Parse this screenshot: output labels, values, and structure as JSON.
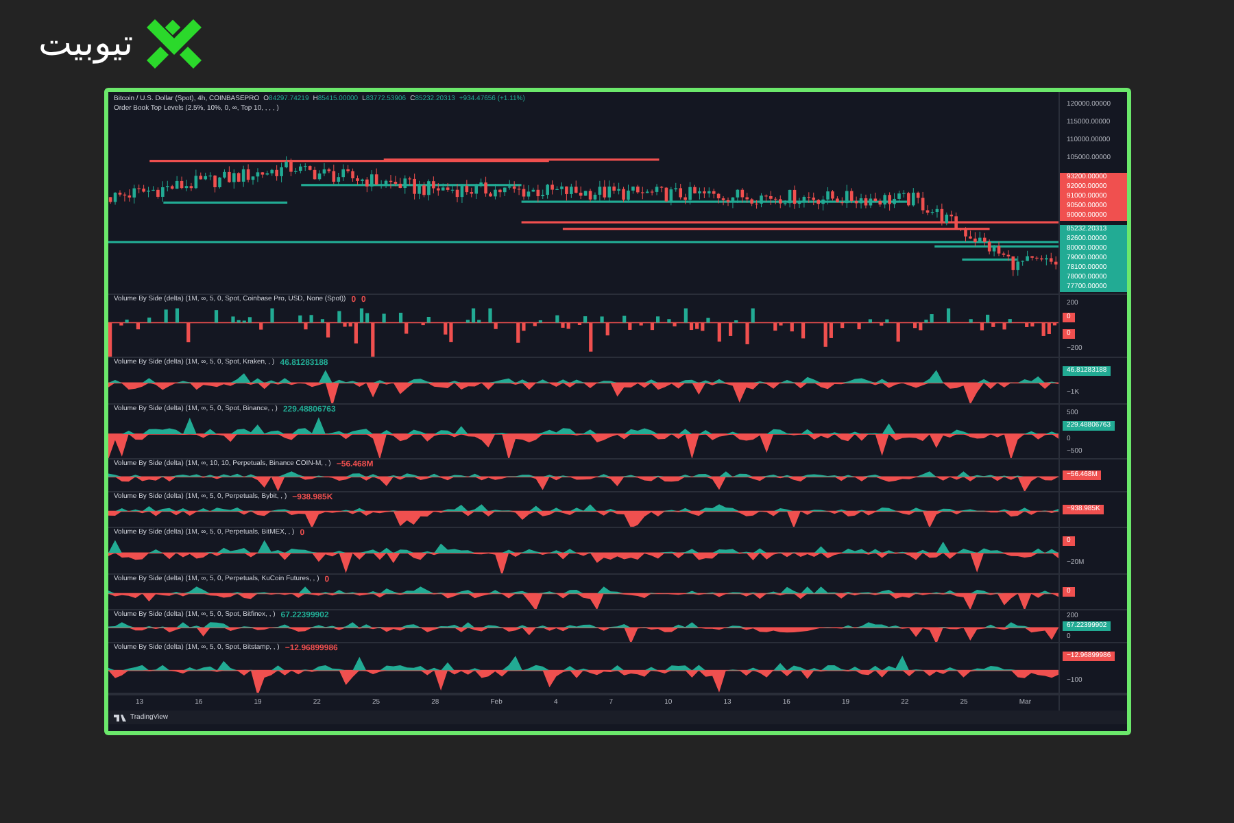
{
  "logo": {
    "wordmark": "تیوبیت"
  },
  "chart": {
    "legend": {
      "symbol": "Bitcoin / U.S. Dollar (Spot), 4h, COINBASEPRO",
      "ohlc": [
        {
          "letter": "O",
          "value": "84297.74219"
        },
        {
          "letter": "H",
          "value": "85415.00000"
        },
        {
          "letter": "L",
          "value": "83772.53906"
        },
        {
          "letter": "C",
          "value": "85232.20313"
        }
      ],
      "change": "+934.47656 (+1.11%)",
      "indicator": "Order Book Top Levels (2.5%, 10%, 0, ∞, Top 10, , , , )"
    },
    "price_axis": {
      "ticks": [
        "120000.00000",
        "115000.00000",
        "110000.00000",
        "105000.00000"
      ],
      "badges": [
        {
          "text": "93200.00000",
          "color": "#f0504f"
        },
        {
          "text": "92000.00000",
          "color": "#f0504f"
        },
        {
          "text": "91000.00000",
          "color": "#f0504f"
        },
        {
          "text": "90500.00000",
          "color": "#f0504f"
        },
        {
          "text": "90000.00000",
          "color": "#f0504f"
        },
        {
          "text": "85232.20313",
          "color": "#22ab94"
        },
        {
          "text": "82600.00000",
          "color": "#22ab94"
        },
        {
          "text": "80000.00000",
          "color": "#22ab94"
        },
        {
          "text": "79000.00000",
          "color": "#22ab94"
        },
        {
          "text": "78100.00000",
          "color": "#22ab94"
        },
        {
          "text": "78000.00000",
          "color": "#22ab94"
        },
        {
          "text": "77700.00000",
          "color": "#22ab94"
        }
      ]
    }
  },
  "panels": [
    {
      "kind": "bars",
      "label": "Volume By Side (delta) (1M, ∞, 5, 0, Spot, Coinbase Pro, USD, None (Spot))",
      "values": [
        {
          "text": "0",
          "color": "#f0504f"
        },
        {
          "text": "0",
          "color": "#f0504f"
        }
      ],
      "axis": [
        {
          "kind": "tick",
          "text": "200"
        },
        {
          "kind": "badge",
          "text": "0",
          "color": "#f0504f"
        },
        {
          "kind": "badge",
          "text": "0",
          "color": "#f0504f"
        },
        {
          "kind": "tick",
          "text": "−200"
        }
      ]
    },
    {
      "kind": "area",
      "label": "Volume By Side (delta) (1M, ∞, 5, 0, Spot, Kraken, , )",
      "values": [
        {
          "text": "46.81283188",
          "color": "#22ab94"
        }
      ],
      "axis": [
        {
          "kind": "badge",
          "text": "46.81283188",
          "color": "#22ab94"
        },
        {
          "kind": "tick",
          "text": "−1K"
        }
      ]
    },
    {
      "kind": "area",
      "label": "Volume By Side (delta) (1M, ∞, 5, 0, Spot, Binance, , )",
      "values": [
        {
          "text": "229.48806763",
          "color": "#22ab94"
        }
      ],
      "axis": [
        {
          "kind": "tick",
          "text": "500"
        },
        {
          "kind": "badge",
          "text": "229.48806763",
          "color": "#22ab94"
        },
        {
          "kind": "tick",
          "text": "0"
        },
        {
          "kind": "tick",
          "text": "−500"
        }
      ]
    },
    {
      "kind": "area",
      "label": "Volume By Side (delta) (1M, ∞, 10, 10, Perpetuals, Binance COIN-M, , )",
      "values": [
        {
          "text": "−56.468M",
          "color": "#f0504f"
        }
      ],
      "axis": [
        {
          "kind": "badge",
          "text": "−56.468M",
          "color": "#f0504f"
        }
      ]
    },
    {
      "kind": "area",
      "label": "Volume By Side (delta) (1M, ∞, 5, 0, Perpetuals, Bybit, , )",
      "values": [
        {
          "text": "−938.985K",
          "color": "#f0504f"
        }
      ],
      "axis": [
        {
          "kind": "badge",
          "text": "−938.985K",
          "color": "#f0504f"
        }
      ]
    },
    {
      "kind": "area",
      "label": "Volume By Side (delta) (1M, ∞, 5, 0, Perpetuals, BitMEX, , )",
      "values": [
        {
          "text": "0",
          "color": "#f0504f"
        }
      ],
      "axis": [
        {
          "kind": "badge",
          "text": "0",
          "color": "#f0504f"
        },
        {
          "kind": "tick",
          "text": "−20M"
        }
      ]
    },
    {
      "kind": "area",
      "label": "Volume By Side (delta) (1M, ∞, 5, 0, Perpetuals, KuCoin Futures, , )",
      "values": [
        {
          "text": "0",
          "color": "#f0504f"
        }
      ],
      "axis": [
        {
          "kind": "badge",
          "text": "0",
          "color": "#f0504f"
        }
      ]
    },
    {
      "kind": "area",
      "label": "Volume By Side (delta) (1M, ∞, 5, 0, Spot, Bitfinex, , )",
      "values": [
        {
          "text": "67.22399902",
          "color": "#22ab94"
        }
      ],
      "axis": [
        {
          "kind": "tick",
          "text": "200"
        },
        {
          "kind": "badge",
          "text": "67.22399902",
          "color": "#22ab94"
        },
        {
          "kind": "tick",
          "text": "0"
        }
      ]
    },
    {
      "kind": "area",
      "label": "Volume By Side (delta) (1M, ∞, 5, 0, Spot, Bitstamp, , )",
      "values": [
        {
          "text": "−12.96899986",
          "color": "#f0504f"
        }
      ],
      "axis": [
        {
          "kind": "badge",
          "text": "−12.96899986",
          "color": "#f0504f"
        },
        {
          "kind": "tick",
          "text": "−100"
        }
      ]
    }
  ],
  "x_axis": [
    "13",
    "16",
    "19",
    "22",
    "25",
    "28",
    "Feb",
    "4",
    "7",
    "10",
    "13",
    "16",
    "19",
    "22",
    "25",
    "Mar"
  ],
  "footer": {
    "brand": "TradingView"
  }
}
